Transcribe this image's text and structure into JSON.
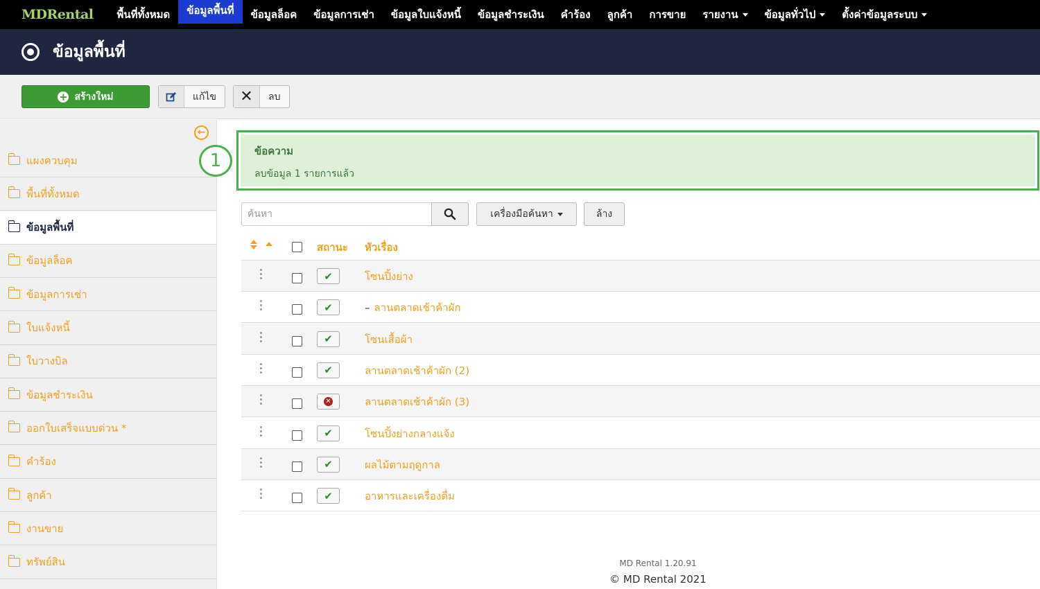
{
  "topnav": {
    "brand": "MDRental",
    "items": [
      {
        "label": "พื้นที่ทั้งหมด",
        "active": false,
        "dropdown": false
      },
      {
        "label": "ข้อมูลพื้นที่",
        "active": true,
        "dropdown": false
      },
      {
        "label": "ข้อมูลล็อค",
        "active": false,
        "dropdown": false
      },
      {
        "label": "ข้อมูลการเช่า",
        "active": false,
        "dropdown": false
      },
      {
        "label": "ข้อมูลใบแจ้งหนี้",
        "active": false,
        "dropdown": false
      },
      {
        "label": "ข้อมูลชำระเงิน",
        "active": false,
        "dropdown": false
      },
      {
        "label": "คำร้อง",
        "active": false,
        "dropdown": false
      },
      {
        "label": "ลูกค้า",
        "active": false,
        "dropdown": false
      },
      {
        "label": "การขาย",
        "active": false,
        "dropdown": false
      },
      {
        "label": "รายงาน",
        "active": false,
        "dropdown": true
      },
      {
        "label": "ข้อมูลทั่วไป",
        "active": false,
        "dropdown": true
      },
      {
        "label": "ตั้งค่าข้อมูลระบบ",
        "active": false,
        "dropdown": true
      }
    ]
  },
  "header": {
    "title": "ข้อมูลพื้นที่",
    "icon": "target-icon"
  },
  "toolbar": {
    "new_label": "สร้างใหม่",
    "edit_label": "แก้ไข",
    "delete_label": "ลบ"
  },
  "sidebar": {
    "items": [
      {
        "label": "แผงควบคุม",
        "active": false
      },
      {
        "label": "พื้นที่ทั้งหมด",
        "active": false
      },
      {
        "label": "ข้อมูลพื้นที่",
        "active": true
      },
      {
        "label": "ข้อมูลล็อค",
        "active": false
      },
      {
        "label": "ข้อมูลการเช่า",
        "active": false
      },
      {
        "label": "ใบแจ้งหนี้",
        "active": false
      },
      {
        "label": "ใบวางบิล",
        "active": false
      },
      {
        "label": "ข้อมูลชำระเงิน",
        "active": false
      },
      {
        "label": "ออกใบเสร็จแบบด่วน *",
        "active": false
      },
      {
        "label": "คำร้อง",
        "active": false
      },
      {
        "label": "ลูกค้า",
        "active": false
      },
      {
        "label": "งานขาย",
        "active": false
      },
      {
        "label": "ทรัพย์สิน",
        "active": false
      }
    ]
  },
  "annotation": {
    "marker": "1"
  },
  "message": {
    "title": "ข้อความ",
    "text": "ลบข้อมูล 1 รายการแล้ว"
  },
  "search": {
    "placeholder": "ค้นหา",
    "value": "",
    "tools_label": "เครื่องมือค้นหา",
    "clear_label": "ล้าง"
  },
  "table": {
    "headers": {
      "status": "สถานะ",
      "title": "หัวเรื่อง"
    },
    "rows": [
      {
        "title": "โซนปิ้งย่าง",
        "prefix": "",
        "published": true
      },
      {
        "title": "ลานตลาดเช้าค้าผัก",
        "prefix": "–",
        "published": true
      },
      {
        "title": "โซนเสื้อผ้า",
        "prefix": "",
        "published": true
      },
      {
        "title": "ลานตลาดเช้าค้าผัก (2)",
        "prefix": "",
        "published": true
      },
      {
        "title": "ลานตลาดเช้าค้าผัก (3)",
        "prefix": "",
        "published": false
      },
      {
        "title": "โซนปิ้งย่างกลางแจ้ง",
        "prefix": "",
        "published": true
      },
      {
        "title": "ผลไม้ตามฤดูกาล",
        "prefix": "",
        "published": true
      },
      {
        "title": "อาหารและเครื่องดื่ม",
        "prefix": "",
        "published": true
      }
    ]
  },
  "footer": {
    "version": "MD Rental 1.20.91",
    "copyright": "© MD Rental 2021"
  },
  "colors": {
    "accent": "#f0a020",
    "nav_active": "#1d3ad1",
    "header_bg": "#1f2640",
    "success": "#3d9b35"
  }
}
